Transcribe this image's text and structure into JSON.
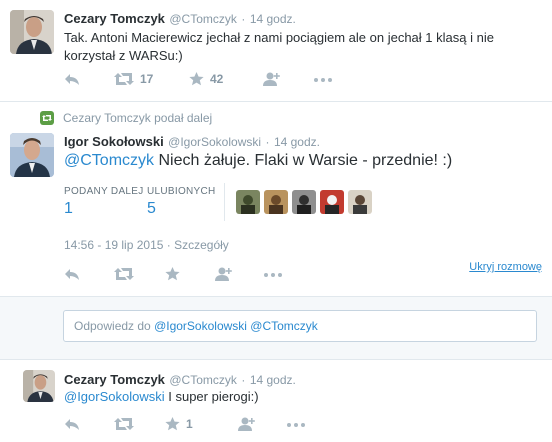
{
  "tweets": {
    "t1": {
      "name": "Cezary Tomczyk",
      "handle": "@CTomczyk",
      "time": "14 godz.",
      "text": "Tak. Antoni Macierewicz jechał z nami pociągiem ale on jechał 1 klasą i nie korzystał z WARSu:)",
      "retweets": "17",
      "favorites": "42"
    },
    "main": {
      "retweet_note": "Cezary Tomczyk podał dalej",
      "name": "Igor Sokołowski",
      "handle": "@IgorSokolowski",
      "time": "14 godz.",
      "mention": "@CTomczyk",
      "text": " Niech żałuje. Flaki w Warsie - przednie! :)",
      "stats": {
        "retweets_label": "PODANY DALEJ",
        "retweets_value": "1",
        "favorites_label": "ULUBIONYCH",
        "favorites_value": "5"
      },
      "timestamp": "14:56 - 19 lip 2015",
      "details_link": "Szczegóły",
      "hide_conversation": "Ukryj rozmowę"
    },
    "reply_box": {
      "prefix": "Odpowiedz do ",
      "mentions": "@IgorSokolowski @CTomczyk"
    },
    "t3": {
      "name": "Cezary Tomczyk",
      "handle": "@CTomczyk",
      "time": "14 godz.",
      "mention": "@IgorSokolowski",
      "text": " I super pierogi:)",
      "favorites": "1"
    }
  },
  "separator": "·",
  "icons": [
    "reply-icon",
    "retweet-icon",
    "favorite-icon",
    "follow-icon",
    "more-icon"
  ],
  "colors": {
    "link": "#2a89cf",
    "retweet_green": "#5c9e45",
    "action_gray": "#aab8c2",
    "border": "#e1e8ed"
  }
}
